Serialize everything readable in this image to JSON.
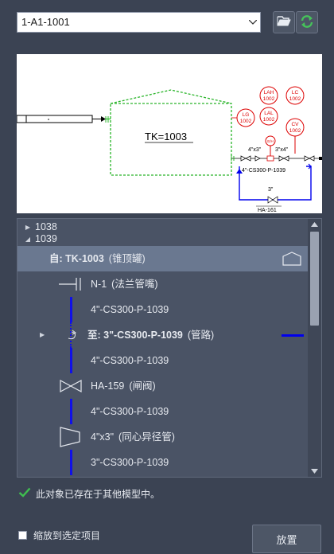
{
  "toolbar": {
    "selected_item": "1-A1-1001",
    "open_icon": "folder-open-icon",
    "refresh_icon": "refresh-icon"
  },
  "preview": {
    "tank_label": "TK=1003",
    "inst": [
      "LAH\n1002",
      "LC\n1002",
      "LG\n1002",
      "LAL\n1002",
      "CV\n1002",
      "E/H"
    ],
    "reducer_left": "4\"x3\"",
    "reducer_right": "3\"x4\"",
    "line_main": "4\"-CS300-P-1039",
    "line_small": "3\"",
    "valve_tag": "HA-161"
  },
  "tree": {
    "group1": "1038",
    "group2": "1039",
    "rows": [
      {
        "prefix": "自: ",
        "name": "TK-1003",
        "desc": "(锥顶罐)"
      },
      {
        "name": "N-1",
        "desc": "(法兰管嘴)"
      },
      {
        "name": "4\"-CS300-P-1039"
      },
      {
        "prefix": "至: ",
        "name": "3\"-CS300-P-1039",
        "desc": "(管路)"
      },
      {
        "name": "4\"-CS300-P-1039"
      },
      {
        "name": "HA-159",
        "desc": "(闸阀)"
      },
      {
        "name": "4\"-CS300-P-1039"
      },
      {
        "name": "4\"x3\"",
        "desc": "(同心异径管)"
      },
      {
        "name": "3\"-CS300-P-1039"
      }
    ]
  },
  "status_text": "此对象已存在于其他模型中。",
  "zoom_label": "缩放到选定项目",
  "place_label": "放置",
  "colors": {
    "pipe": "#0000ee",
    "selected": "#6a7890",
    "check": "#3fbf4f"
  }
}
